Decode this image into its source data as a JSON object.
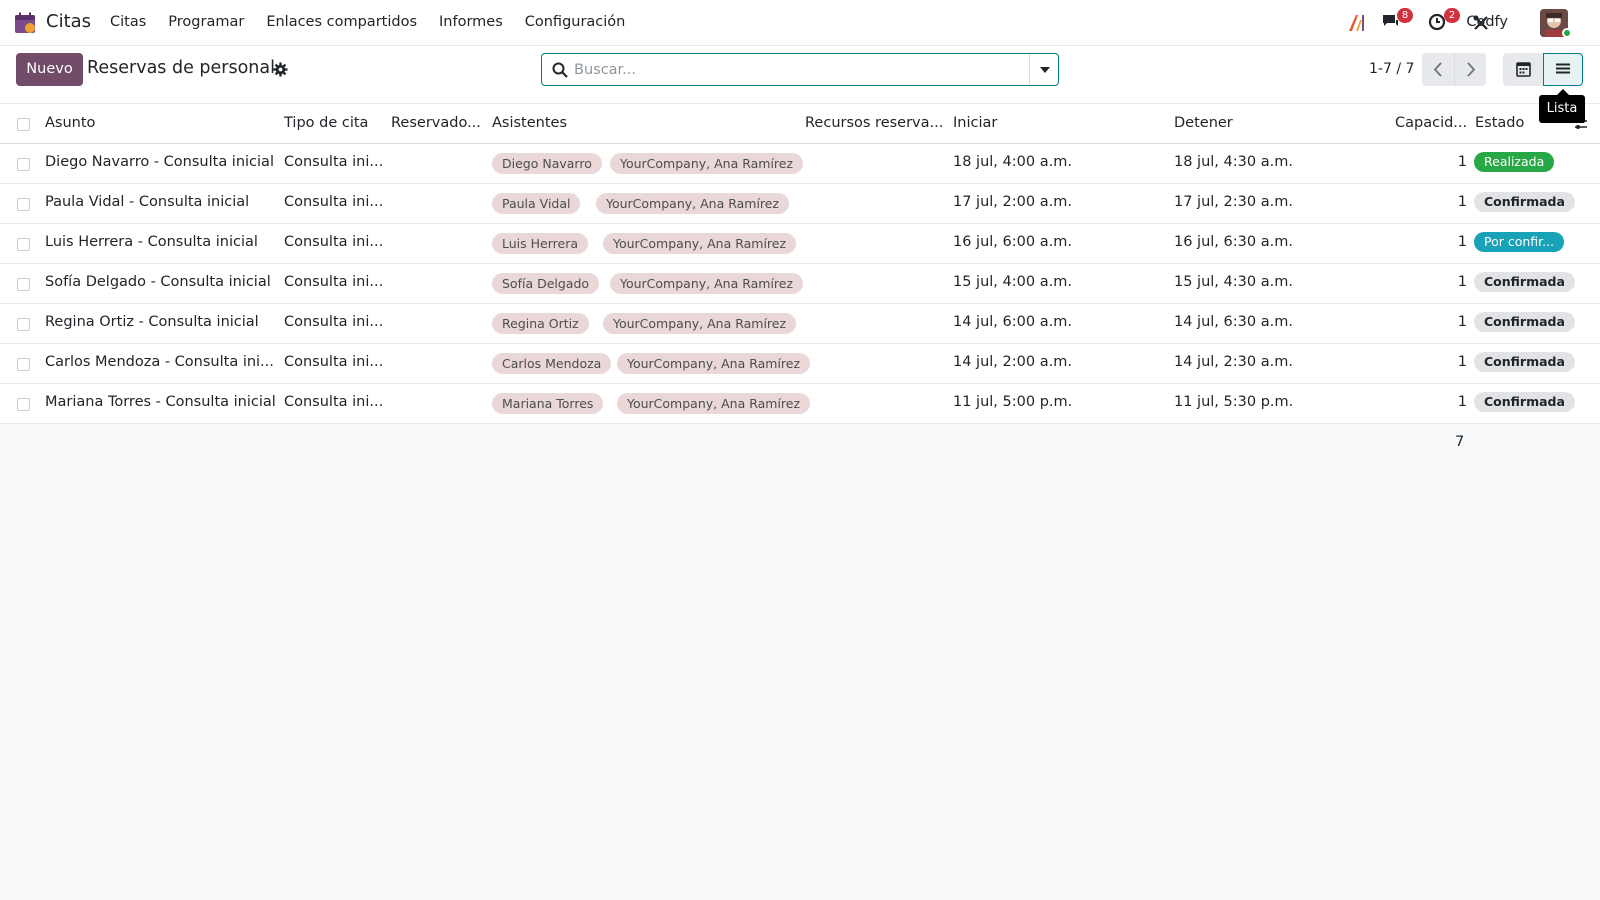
{
  "navbar": {
    "app_name": "Citas",
    "menu": [
      "Citas",
      "Programar",
      "Enlaces compartidos",
      "Informes",
      "Configuración"
    ],
    "messages_badge": "8",
    "activities_badge": "2",
    "company": "Codfy"
  },
  "control_panel": {
    "new_button": "Nuevo",
    "title": "Reservas de personal",
    "search_placeholder": "Buscar...",
    "pager": "1-7 / 7",
    "tooltip": "Lista"
  },
  "table": {
    "headers": {
      "subject": "Asunto",
      "type": "Tipo de cita",
      "booked": "Reservado...",
      "attendees": "Asistentes",
      "resources": "Recursos reserva...",
      "start": "Iniciar",
      "stop": "Detener",
      "capacity": "Capacid...",
      "state": "Estado"
    },
    "rows": [
      {
        "subject": "Diego Navarro - Consulta inicial",
        "type": "Consulta ini...",
        "attendee1": "Diego Navarro",
        "attendee2": "YourCompany, Ana Ramírez",
        "start": "18 jul, 4:00 a.m.",
        "stop": "18 jul, 4:30 a.m.",
        "capacity": "1",
        "state": "Realizada"
      },
      {
        "subject": "Paula Vidal - Consulta inicial",
        "type": "Consulta ini...",
        "attendee1": "Paula Vidal",
        "attendee2": "YourCompany, Ana Ramírez",
        "start": "17 jul, 2:00 a.m.",
        "stop": "17 jul, 2:30 a.m.",
        "capacity": "1",
        "state": "Confirmada"
      },
      {
        "subject": "Luis Herrera - Consulta inicial",
        "type": "Consulta ini...",
        "attendee1": "Luis Herrera",
        "attendee2": "YourCompany, Ana Ramírez",
        "start": "16 jul, 6:00 a.m.",
        "stop": "16 jul, 6:30 a.m.",
        "capacity": "1",
        "state": "Por confir..."
      },
      {
        "subject": "Sofía Delgado - Consulta inicial",
        "type": "Consulta ini...",
        "attendee1": "Sofía Delgado",
        "attendee2": "YourCompany, Ana Ramírez",
        "start": "15 jul, 4:00 a.m.",
        "stop": "15 jul, 4:30 a.m.",
        "capacity": "1",
        "state": "Confirmada"
      },
      {
        "subject": "Regina Ortiz - Consulta inicial",
        "type": "Consulta ini...",
        "attendee1": "Regina Ortiz",
        "attendee2": "YourCompany, Ana Ramírez",
        "start": "14 jul, 6:00 a.m.",
        "stop": "14 jul, 6:30 a.m.",
        "capacity": "1",
        "state": "Confirmada"
      },
      {
        "subject": "Carlos Mendoza - Consulta ini...",
        "type": "Consulta ini...",
        "attendee1": "Carlos Mendoza",
        "attendee2": "YourCompany, Ana Ramírez",
        "start": "14 jul, 2:00 a.m.",
        "stop": "14 jul, 2:30 a.m.",
        "capacity": "1",
        "state": "Confirmada"
      },
      {
        "subject": "Mariana Torres - Consulta inicial",
        "type": "Consulta ini...",
        "attendee1": "Mariana Torres",
        "attendee2": "YourCompany, Ana Ramírez",
        "start": "11 jul, 5:00 p.m.",
        "stop": "11 jul, 5:30 p.m.",
        "capacity": "1",
        "state": "Confirmada"
      }
    ],
    "capacity_total": "7"
  },
  "colors": {
    "brand": "#714b67",
    "accent": "#017e84",
    "status_done": "#28a745",
    "status_pending": "#17a2b8",
    "tag_bg": "#ead8d8"
  }
}
